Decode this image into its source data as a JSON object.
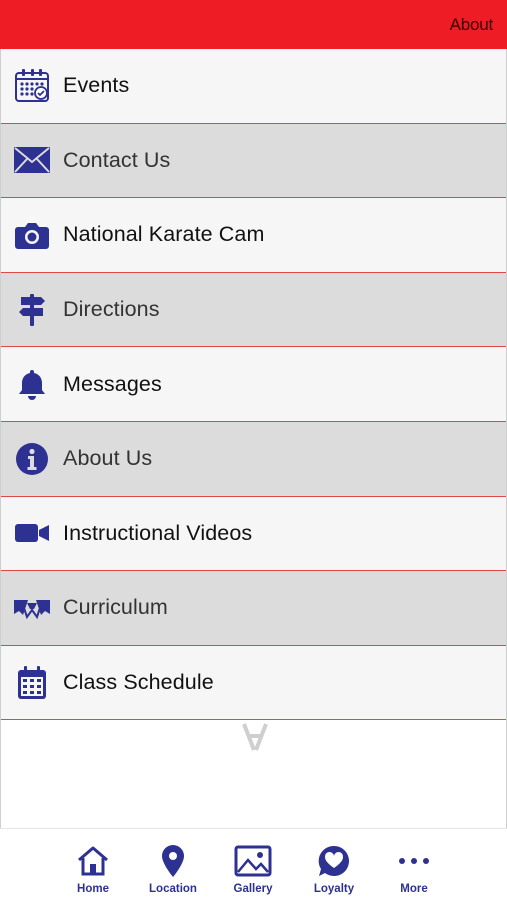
{
  "header": {
    "title": "About"
  },
  "menu": {
    "items": [
      {
        "label": "Events",
        "icon": "calendar-check-icon"
      },
      {
        "label": "Contact Us",
        "icon": "envelope-icon"
      },
      {
        "label": "National Karate Cam",
        "icon": "camera-icon"
      },
      {
        "label": "Directions",
        "icon": "signpost-icon"
      },
      {
        "label": "Messages",
        "icon": "bell-icon"
      },
      {
        "label": "About Us",
        "icon": "info-circle-icon"
      },
      {
        "label": "Instructional Videos",
        "icon": "video-camera-icon"
      },
      {
        "label": "Curriculum",
        "icon": "ribbon-bow-icon"
      },
      {
        "label": "Class Schedule",
        "icon": "calendar-icon"
      }
    ]
  },
  "tabbar": {
    "tabs": [
      {
        "label": "Home",
        "icon": "home-icon"
      },
      {
        "label": "Location",
        "icon": "map-pin-icon"
      },
      {
        "label": "Gallery",
        "icon": "image-icon"
      },
      {
        "label": "Loyalty",
        "icon": "heart-bubble-icon"
      },
      {
        "label": "More",
        "icon": "ellipsis-icon"
      }
    ]
  },
  "colors": {
    "header_bg": "#ee1c24",
    "icon": "#2d3192",
    "divider": "#e04848",
    "row_light": "#f6f6f6",
    "row_dark": "#dcdcdc"
  }
}
